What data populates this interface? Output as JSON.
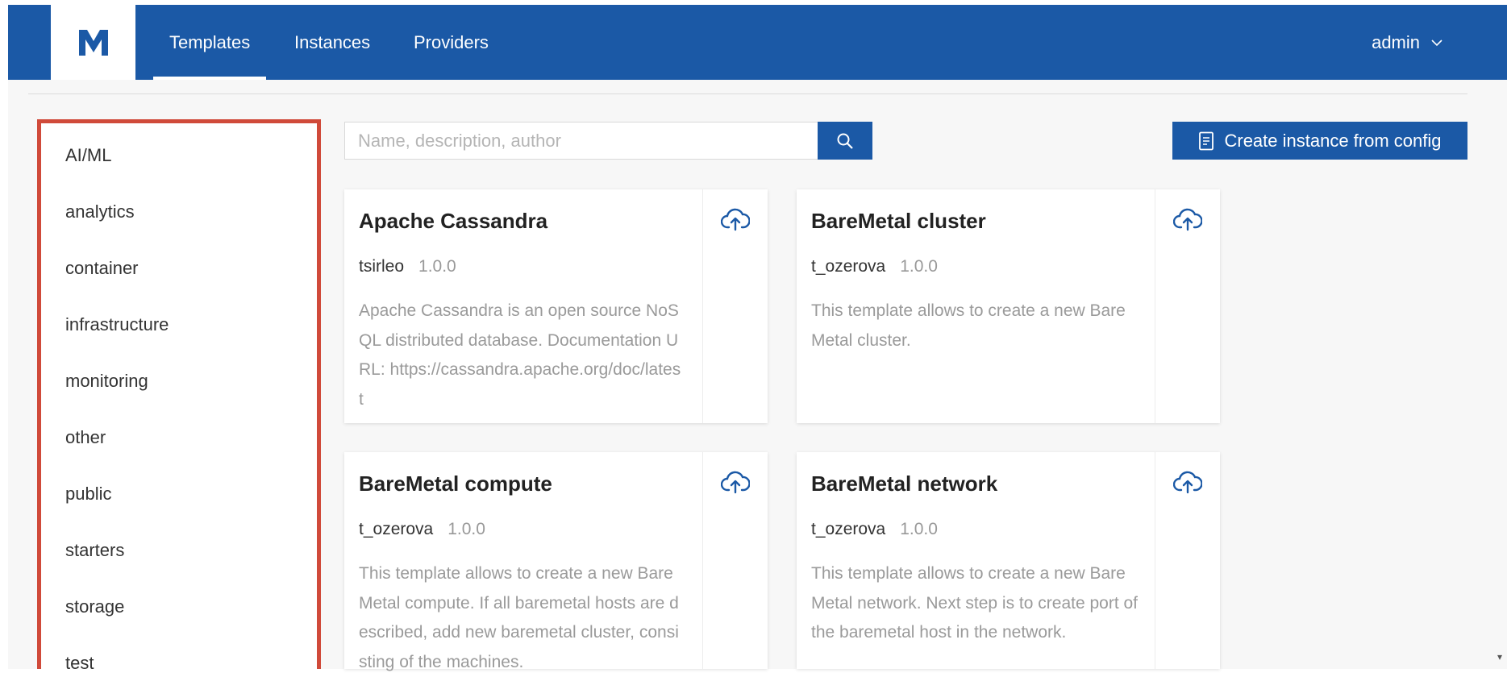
{
  "header": {
    "tabs": [
      {
        "label": "Templates",
        "active": true
      },
      {
        "label": "Instances",
        "active": false
      },
      {
        "label": "Providers",
        "active": false
      }
    ],
    "user": "admin",
    "brand_color": "#1b59a6"
  },
  "sidebar": {
    "categories": [
      "AI/ML",
      "analytics",
      "container",
      "infrastructure",
      "monitoring",
      "other",
      "public",
      "starters",
      "storage",
      "test"
    ]
  },
  "search": {
    "placeholder": "Name, description, author",
    "value": ""
  },
  "actions": {
    "create_label": "Create instance from config"
  },
  "templates": [
    {
      "name": "Apache Cassandra",
      "author": "tsirleo",
      "version": "1.0.0",
      "description": "Apache Cassandra is an open source NoSQL distributed database. Documentation URL: https://cassandra.apache.org/doc/latest"
    },
    {
      "name": "BareMetal cluster",
      "author": "t_ozerova",
      "version": "1.0.0",
      "description": "This template allows to create a new BareMetal cluster."
    },
    {
      "name": "BareMetal compute",
      "author": "t_ozerova",
      "version": "1.0.0",
      "description": "This template allows to create a new BareMetal compute. If all baremetal hosts are described, add new baremetal cluster, consisting of the machines."
    },
    {
      "name": "BareMetal network",
      "author": "t_ozerova",
      "version": "1.0.0",
      "description": "This template allows to create a new BareMetal network. Next step is to create port of the baremetal host in the network."
    }
  ]
}
